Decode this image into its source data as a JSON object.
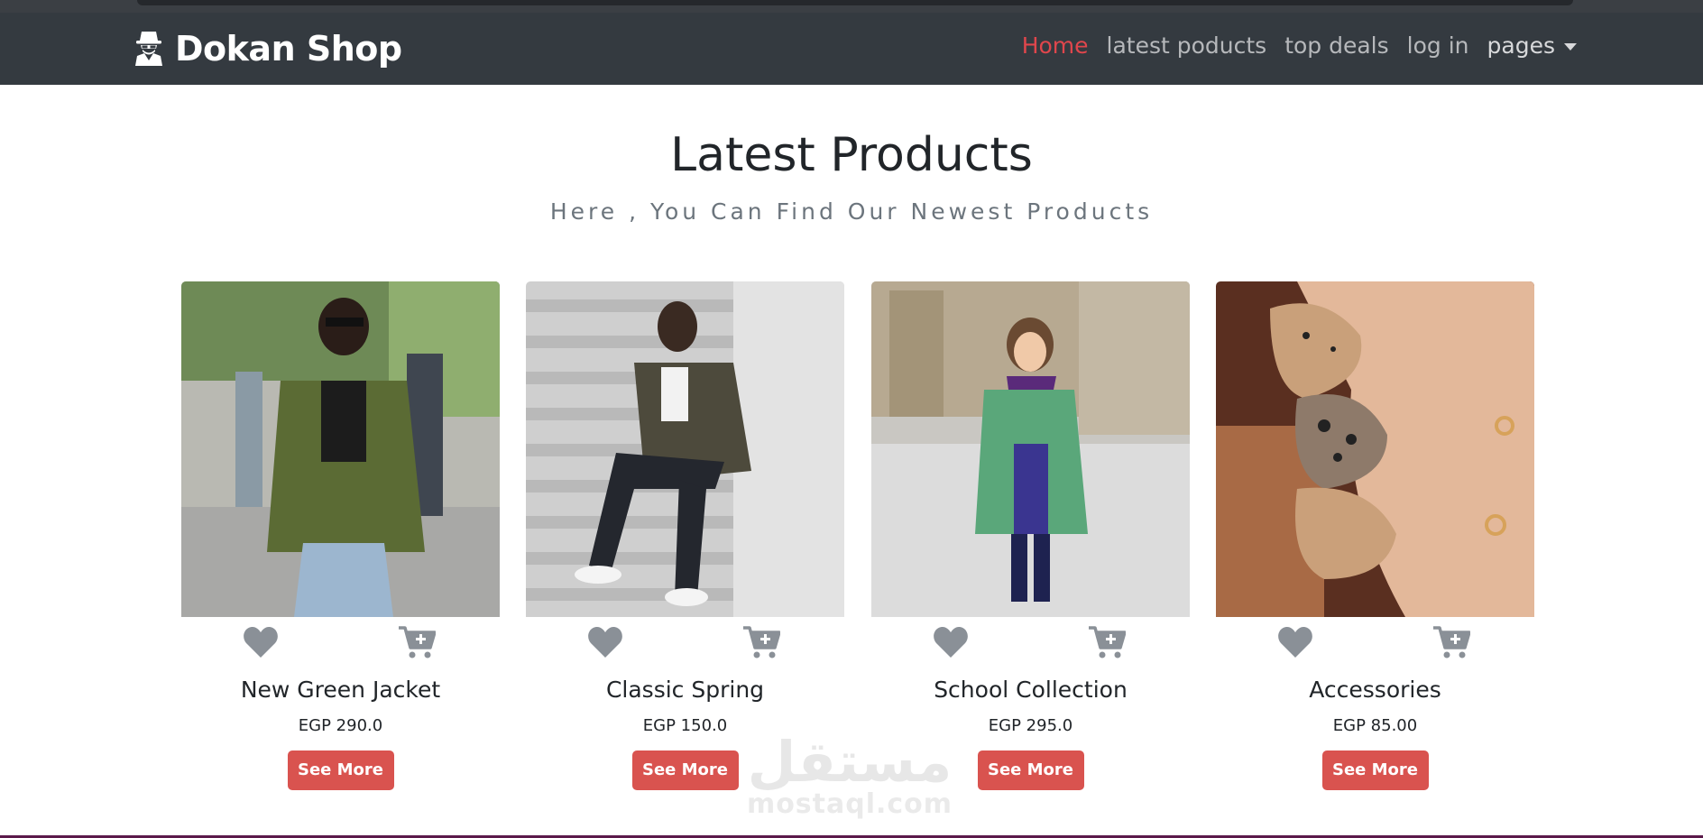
{
  "brand": {
    "name": "Dokan Shop",
    "icon": "spy-icon"
  },
  "nav": {
    "links": [
      {
        "label": "Home",
        "active": true
      },
      {
        "label": "latest poducts",
        "active": false
      },
      {
        "label": "top deals",
        "active": false
      },
      {
        "label": "log in",
        "active": false
      }
    ],
    "dropdown_label": "pages"
  },
  "section": {
    "title": "Latest Products",
    "subtitle": "Here , You Can Find Our Newest Products"
  },
  "products": [
    {
      "name": "New Green Jacket",
      "price": "EGP 290.0",
      "button": "See More",
      "image": "woman-green-blazer-photo"
    },
    {
      "name": "Classic Spring",
      "price": "EGP 150.0",
      "button": "See More",
      "image": "man-camo-jacket-stairs-photo"
    },
    {
      "name": "School Collection",
      "price": "EGP 295.0",
      "button": "See More",
      "image": "girl-green-coat-photo"
    },
    {
      "name": "Accessories",
      "price": "EGP 85.00",
      "button": "See More",
      "image": "jeweled-nails-photo"
    }
  ],
  "watermark": {
    "arabic": "مستقل",
    "latin": "mostaql.com"
  },
  "colors": {
    "navbar": "#343a40",
    "active_link": "#e0464c",
    "button": "#d9534f",
    "icon_gray": "#8a9097"
  }
}
